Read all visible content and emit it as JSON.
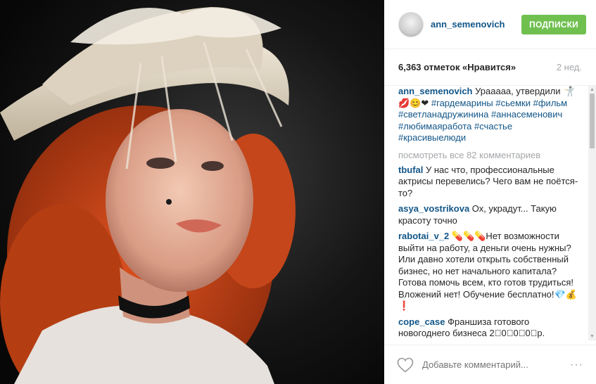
{
  "post": {
    "username": "ann_semenovich",
    "follow_label": "ПОДПИСКИ",
    "likes": "6,363 отметок «Нравится»",
    "time": "2 нед."
  },
  "caption": {
    "user": "ann_semenovich",
    "text_plain": " Урааааа, утвердили ",
    "emoji": "🤺💋😊❤ ",
    "tags": [
      "#гардемарины",
      "#сьемки",
      "#фильм",
      "#светланадружинина",
      "#аннасеменович",
      "#любимаяработа",
      "#счастье",
      "#красивыелюди"
    ]
  },
  "view_all": "посмотреть все 82 комментариев",
  "comments": [
    {
      "user": "tbufal",
      "text": " У нас что, профессиональные актрисы перевелись? Чего вам не поётся-то?"
    },
    {
      "user": "asya_vostrikova",
      "text": " Ох, украдут... Такую красоту точно"
    },
    {
      "user": "rabotai_v_2",
      "text": " 💊💊💊Нет возможности выйти на работу, а деньги очень нужны? Или давно хотели открыть собственный бизнес, но нет начального капитала? Готова помочь всем, кто готов трудиться! Вложений нет! Обучение бесплатно!💎💰❗"
    },
    {
      "user": "cope_case",
      "text": " Франшиза готового новогоднего бизнеса 2⃣0⃣0⃣0⃣р."
    }
  ],
  "footer": {
    "add_comment_placeholder": "Добавьте комментарий...",
    "more": "···"
  },
  "icons": {
    "like": "heart-outline-icon",
    "options": "ellipsis-icon"
  },
  "colors": {
    "link": "#125688",
    "follow_bg": "#70c050",
    "muted": "#a5a7aa"
  }
}
